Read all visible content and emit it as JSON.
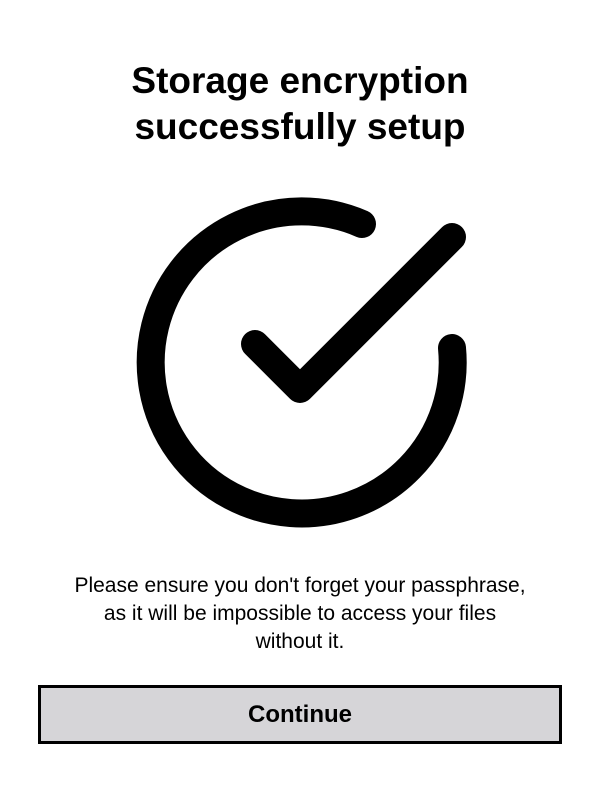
{
  "dialog": {
    "title_line1": "Storage encryption",
    "title_line2": "successfully setup",
    "icon": "check-circle-icon",
    "message_line1": "Please ensure you don't forget your passphrase,",
    "message_line2": "as it will be impossible to access your files",
    "message_line3": "without it.",
    "continue_label": "Continue"
  },
  "colors": {
    "background": "#ffffff",
    "foreground": "#000000",
    "button_background": "#d6d5d8"
  }
}
